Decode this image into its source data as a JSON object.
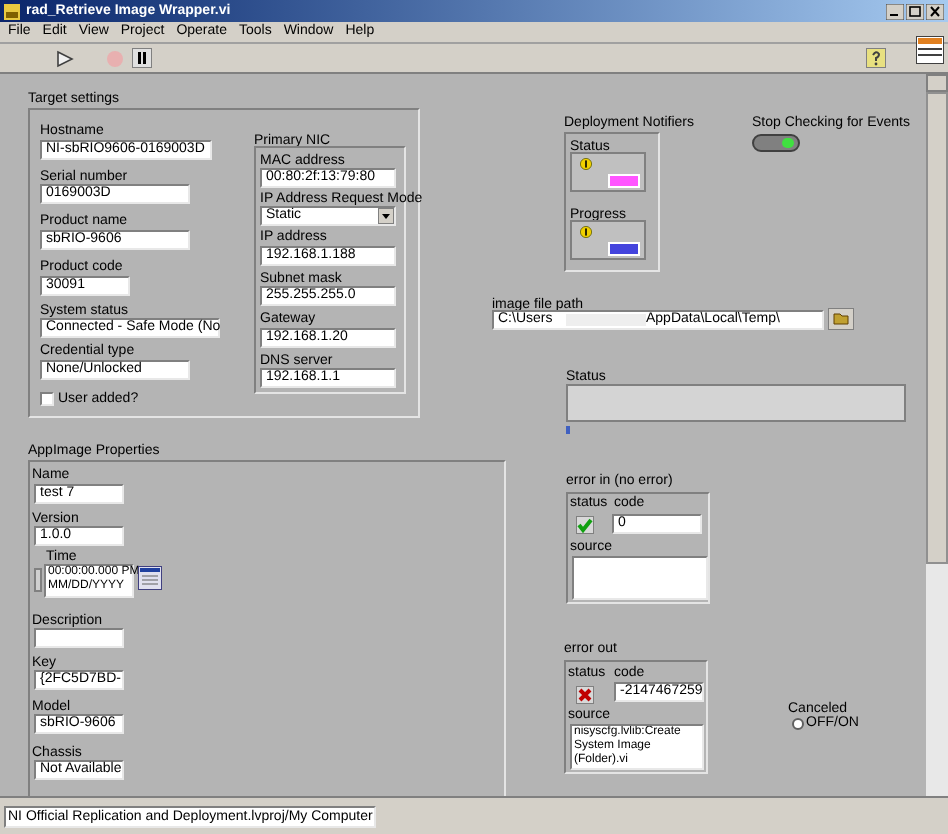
{
  "window": {
    "title": "rad_Retrieve Image Wrapper.vi",
    "menu": [
      "File",
      "Edit",
      "View",
      "Project",
      "Operate",
      "Tools",
      "Window",
      "Help"
    ]
  },
  "target_settings": {
    "label": "Target settings",
    "fields": [
      {
        "label": "Hostname",
        "value": "NI-sbRIO9606-0169003D"
      },
      {
        "label": "Serial number",
        "value": "0169003D"
      },
      {
        "label": "Product name",
        "value": "sbRIO-9606"
      },
      {
        "label": "Product code",
        "value": "30091"
      },
      {
        "label": "System status",
        "value": "Connected - Safe Mode (No"
      },
      {
        "label": "Credential type",
        "value": "None/Unlocked"
      }
    ],
    "user_added": {
      "label": "User added?",
      "checked": false
    },
    "primary_nic": {
      "label": "Primary NIC",
      "fields": [
        {
          "label": "MAC address",
          "value": "00:80:2f:13:79:80",
          "kind": "text"
        },
        {
          "label": "IP Address Request Mode",
          "value": "Static",
          "kind": "dropdown"
        },
        {
          "label": "IP address",
          "value": "192.168.1.188",
          "kind": "text"
        },
        {
          "label": "Subnet mask",
          "value": "255.255.255.0",
          "kind": "text"
        },
        {
          "label": "Gateway",
          "value": "192.168.1.20",
          "kind": "text"
        },
        {
          "label": "DNS server",
          "value": "192.168.1.1",
          "kind": "text"
        }
      ]
    }
  },
  "deployment_notifiers": {
    "label": "Deployment Notifiers",
    "items": [
      {
        "label": "Status",
        "color": "#ff55ff"
      },
      {
        "label": "Progress",
        "color": "#4444dd"
      }
    ]
  },
  "stop_checking": {
    "label": "Stop Checking for Events",
    "on": true
  },
  "image_file_path": {
    "label": "image file path",
    "value_start": "C:\\Users",
    "value_end": "AppData\\Local\\Temp\\"
  },
  "status": {
    "label": "Status"
  },
  "app_image": {
    "label": "AppImage Properties",
    "fields": [
      {
        "label": "Name",
        "value": "test 7",
        "kind": "text"
      },
      {
        "label": "Version",
        "value": "1.0.0",
        "kind": "text"
      },
      {
        "label": "Time",
        "value": "00:00:00.000 PM",
        "value2": "MM/DD/YYYY",
        "kind": "time"
      },
      {
        "label": "Description",
        "kind": "text"
      },
      {
        "label": "Key",
        "value": "{2FC5D7BD-",
        "kind": "text"
      },
      {
        "label": "Model",
        "value": "sbRIO-9606",
        "kind": "text"
      },
      {
        "label": "Chassis",
        "value": "Not Available",
        "kind": "text"
      }
    ]
  },
  "error_in": {
    "label": "error in (no error)",
    "status_label": "status",
    "code_label": "code",
    "error": false,
    "code": "0",
    "source_label": "source"
  },
  "error_out": {
    "label": "error out",
    "status_label": "status",
    "code_label": "code",
    "error": true,
    "code": "-2147467259",
    "source_label": "source",
    "source": "nisyscfg.lvlib:Create System Image (Folder).vi"
  },
  "canceled": {
    "label": "Canceled",
    "text": "OFF/ON",
    "on": false
  },
  "status_bar": {
    "text": "NI Official Replication and Deployment.lvproj/My Computer"
  }
}
